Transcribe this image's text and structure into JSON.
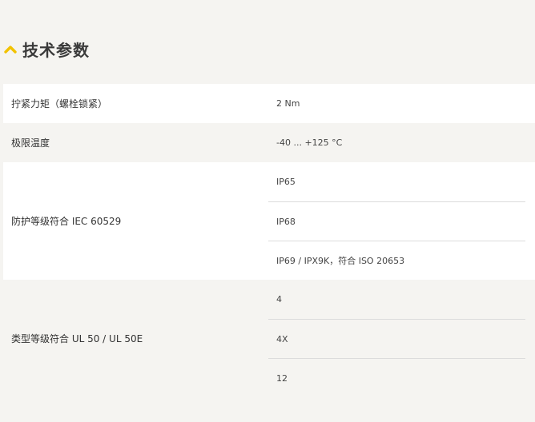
{
  "section": {
    "title": "技术参数",
    "icon": "chevron-up-icon",
    "accent_color": "#f2c200"
  },
  "specs": [
    {
      "label": "拧紧力矩（螺栓锁紧）",
      "values": [
        "2 Nm"
      ]
    },
    {
      "label": "极限温度",
      "values": [
        "-40 ... +125 °C"
      ]
    },
    {
      "label": "防护等级符合 IEC 60529",
      "values": [
        "IP65",
        "IP68",
        "IP69 / IPX9K，符合 ISO 20653"
      ]
    },
    {
      "label": "类型等级符合 UL 50 / UL 50E",
      "values": [
        "4",
        "4X",
        "12"
      ]
    }
  ]
}
